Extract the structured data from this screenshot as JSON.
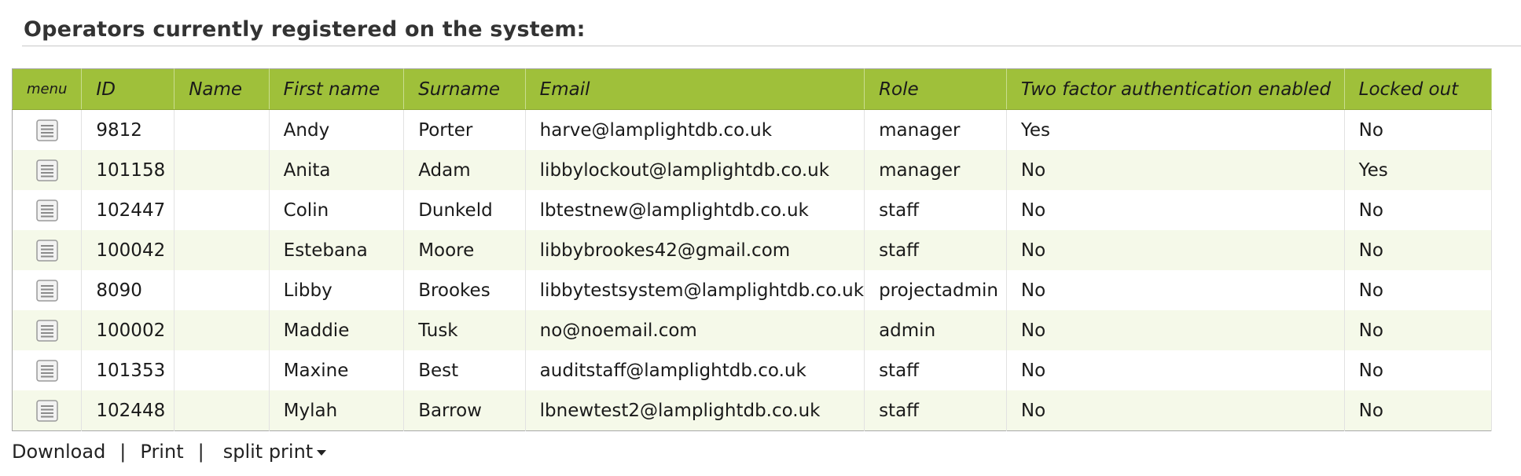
{
  "page": {
    "heading": "Operators currently registered on the system:"
  },
  "table": {
    "columns": {
      "menu": "menu",
      "id": "ID",
      "name": "Name",
      "first_name": "First name",
      "surname": "Surname",
      "email": "Email",
      "role": "Role",
      "two_factor": "Two factor authentication enabled",
      "locked_out": "Locked out"
    },
    "header_color": "#9fc03a",
    "stripe_color": "#f5f9e9",
    "rows": [
      {
        "id": "9812",
        "name": "",
        "first_name": "Andy",
        "surname": "Porter",
        "email": "harve@lamplightdb.co.uk",
        "role": "manager",
        "two_factor": "Yes",
        "locked_out": "No"
      },
      {
        "id": "101158",
        "name": "",
        "first_name": "Anita",
        "surname": "Adam",
        "email": "libbylockout@lamplightdb.co.uk",
        "role": "manager",
        "two_factor": "No",
        "locked_out": "Yes"
      },
      {
        "id": "102447",
        "name": "",
        "first_name": "Colin",
        "surname": "Dunkeld",
        "email": "lbtestnew@lamplightdb.co.uk",
        "role": "staff",
        "two_factor": "No",
        "locked_out": "No"
      },
      {
        "id": "100042",
        "name": "",
        "first_name": "Estebana",
        "surname": "Moore",
        "email": "libbybrookes42@gmail.com",
        "role": "staff",
        "two_factor": "No",
        "locked_out": "No"
      },
      {
        "id": "8090",
        "name": "",
        "first_name": "Libby",
        "surname": "Brookes",
        "email": "libbytestsystem@lamplightdb.co.uk",
        "role": "projectadmin",
        "two_factor": "No",
        "locked_out": "No"
      },
      {
        "id": "100002",
        "name": "",
        "first_name": "Maddie",
        "surname": "Tusk",
        "email": "no@noemail.com",
        "role": "admin",
        "two_factor": "No",
        "locked_out": "No"
      },
      {
        "id": "101353",
        "name": "",
        "first_name": "Maxine",
        "surname": "Best",
        "email": "auditstaff@lamplightdb.co.uk",
        "role": "staff",
        "two_factor": "No",
        "locked_out": "No"
      },
      {
        "id": "102448",
        "name": "",
        "first_name": "Mylah",
        "surname": "Barrow",
        "email": "lbnewtest2@lamplightdb.co.uk",
        "role": "staff",
        "two_factor": "No",
        "locked_out": "No"
      }
    ],
    "row_icon": "hamburger-menu-icon"
  },
  "footer": {
    "download": "Download",
    "print": "Print",
    "split_print": "split print",
    "separator": "|"
  }
}
